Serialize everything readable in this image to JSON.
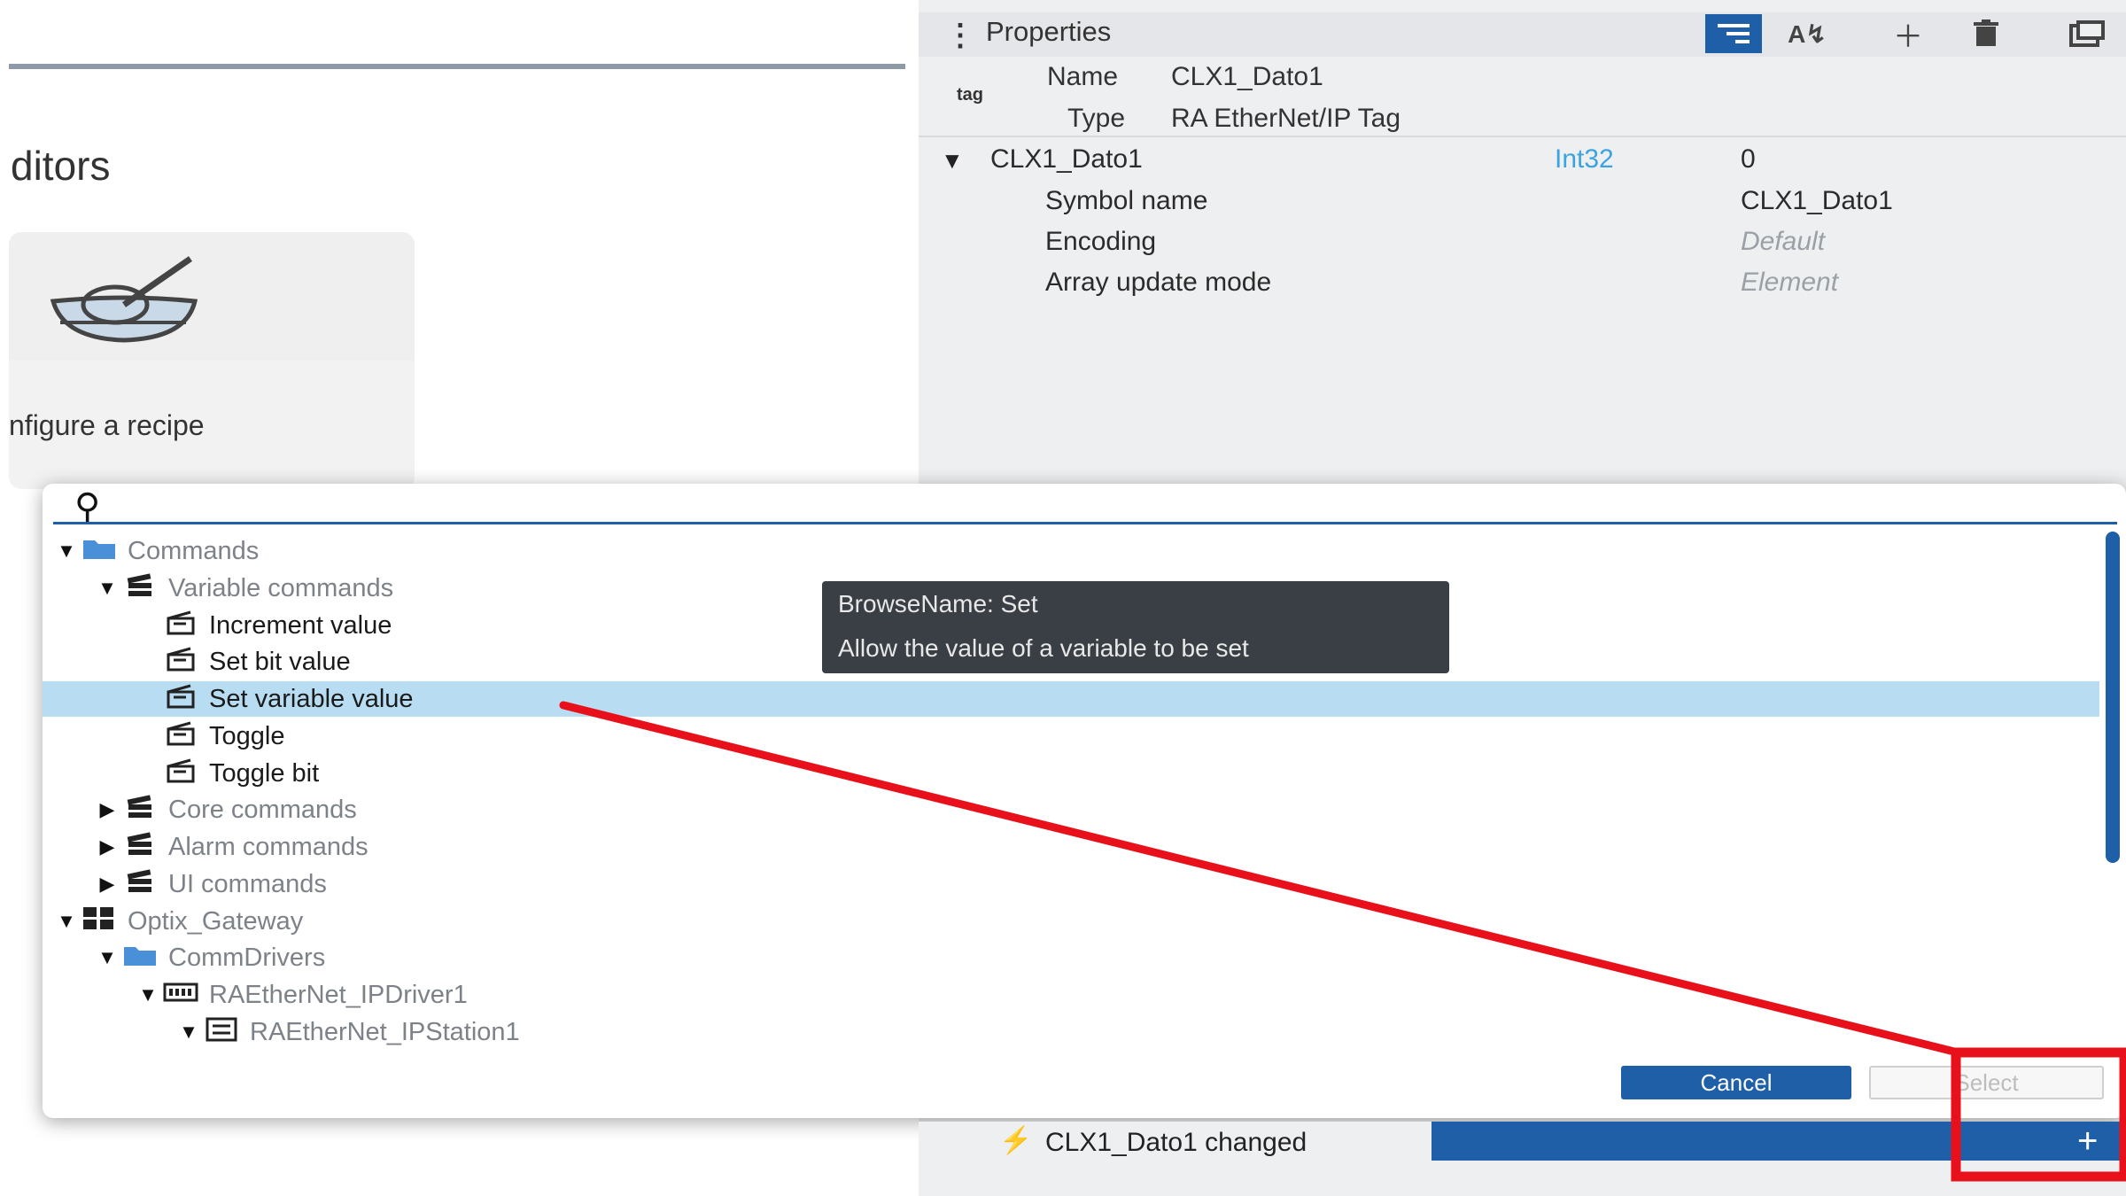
{
  "editors": {
    "title": "ditors",
    "recipe_card_label": "nfigure a recipe"
  },
  "properties": {
    "title": "Properties",
    "toolbar": {
      "sort_icon": "sort-icon",
      "az_icon": "az-sort-icon",
      "add_icon": "plus-icon",
      "delete_icon": "trash-icon",
      "more_icon": "window-icon"
    },
    "tag_label": "tag",
    "name_key": "Name",
    "name_value": "CLX1_Dato1",
    "type_key": "Type",
    "type_value": "RA EtherNet/IP Tag",
    "variable": {
      "name": "CLX1_Dato1",
      "datatype": "Int32",
      "value": "0"
    },
    "rows": [
      {
        "key": "Symbol name",
        "value": "CLX1_Dato1",
        "italic": false
      },
      {
        "key": "Encoding",
        "value": "Default",
        "italic": true
      },
      {
        "key": "Array update mode",
        "value": "Element",
        "italic": true
      }
    ]
  },
  "dialog": {
    "search_placeholder": "",
    "tree": [
      {
        "label": "Commands",
        "depth": 0,
        "caret": "open",
        "icon": "folder-icon",
        "style": "dim"
      },
      {
        "label": "Variable commands",
        "depth": 1,
        "caret": "open",
        "icon": "library-icon",
        "style": "dim"
      },
      {
        "label": "Increment value",
        "depth": 2,
        "caret": "none",
        "icon": "command-icon",
        "style": "strong"
      },
      {
        "label": "Set bit value",
        "depth": 2,
        "caret": "none",
        "icon": "command-icon",
        "style": "strong"
      },
      {
        "label": "Set variable value",
        "depth": 2,
        "caret": "none",
        "icon": "command-icon",
        "style": "strong",
        "selected": true
      },
      {
        "label": "Toggle",
        "depth": 2,
        "caret": "none",
        "icon": "command-icon",
        "style": "strong"
      },
      {
        "label": "Toggle bit",
        "depth": 2,
        "caret": "none",
        "icon": "command-icon",
        "style": "strong"
      },
      {
        "label": "Core commands",
        "depth": 1,
        "caret": "closed",
        "icon": "library-icon",
        "style": "dim"
      },
      {
        "label": "Alarm commands",
        "depth": 1,
        "caret": "closed",
        "icon": "library-icon",
        "style": "dim"
      },
      {
        "label": "UI commands",
        "depth": 1,
        "caret": "closed",
        "icon": "library-icon",
        "style": "dim"
      },
      {
        "label": "Optix_Gateway",
        "depth": 0,
        "caret": "open",
        "icon": "project-icon",
        "style": "dim"
      },
      {
        "label": "CommDrivers",
        "depth": 1,
        "caret": "open",
        "icon": "folder-icon",
        "style": "dim"
      },
      {
        "label": "RAEtherNet_IPDriver1",
        "depth": 2,
        "caret": "open",
        "icon": "driver-icon",
        "style": "dim"
      },
      {
        "label": "RAEtherNet_IPStation1",
        "depth": 3,
        "caret": "open",
        "icon": "station-icon",
        "style": "dim"
      }
    ],
    "tooltip": {
      "line1": "BrowseName: Set",
      "line2": "Allow the value of a variable to be set"
    },
    "cancel_label": "Cancel",
    "select_label": "Select"
  },
  "events": {
    "event_label": "CLX1_Dato1 changed",
    "add_icon": "plus-icon",
    "event_icon": "lightning-icon"
  },
  "annotation_color": "#e8101a"
}
